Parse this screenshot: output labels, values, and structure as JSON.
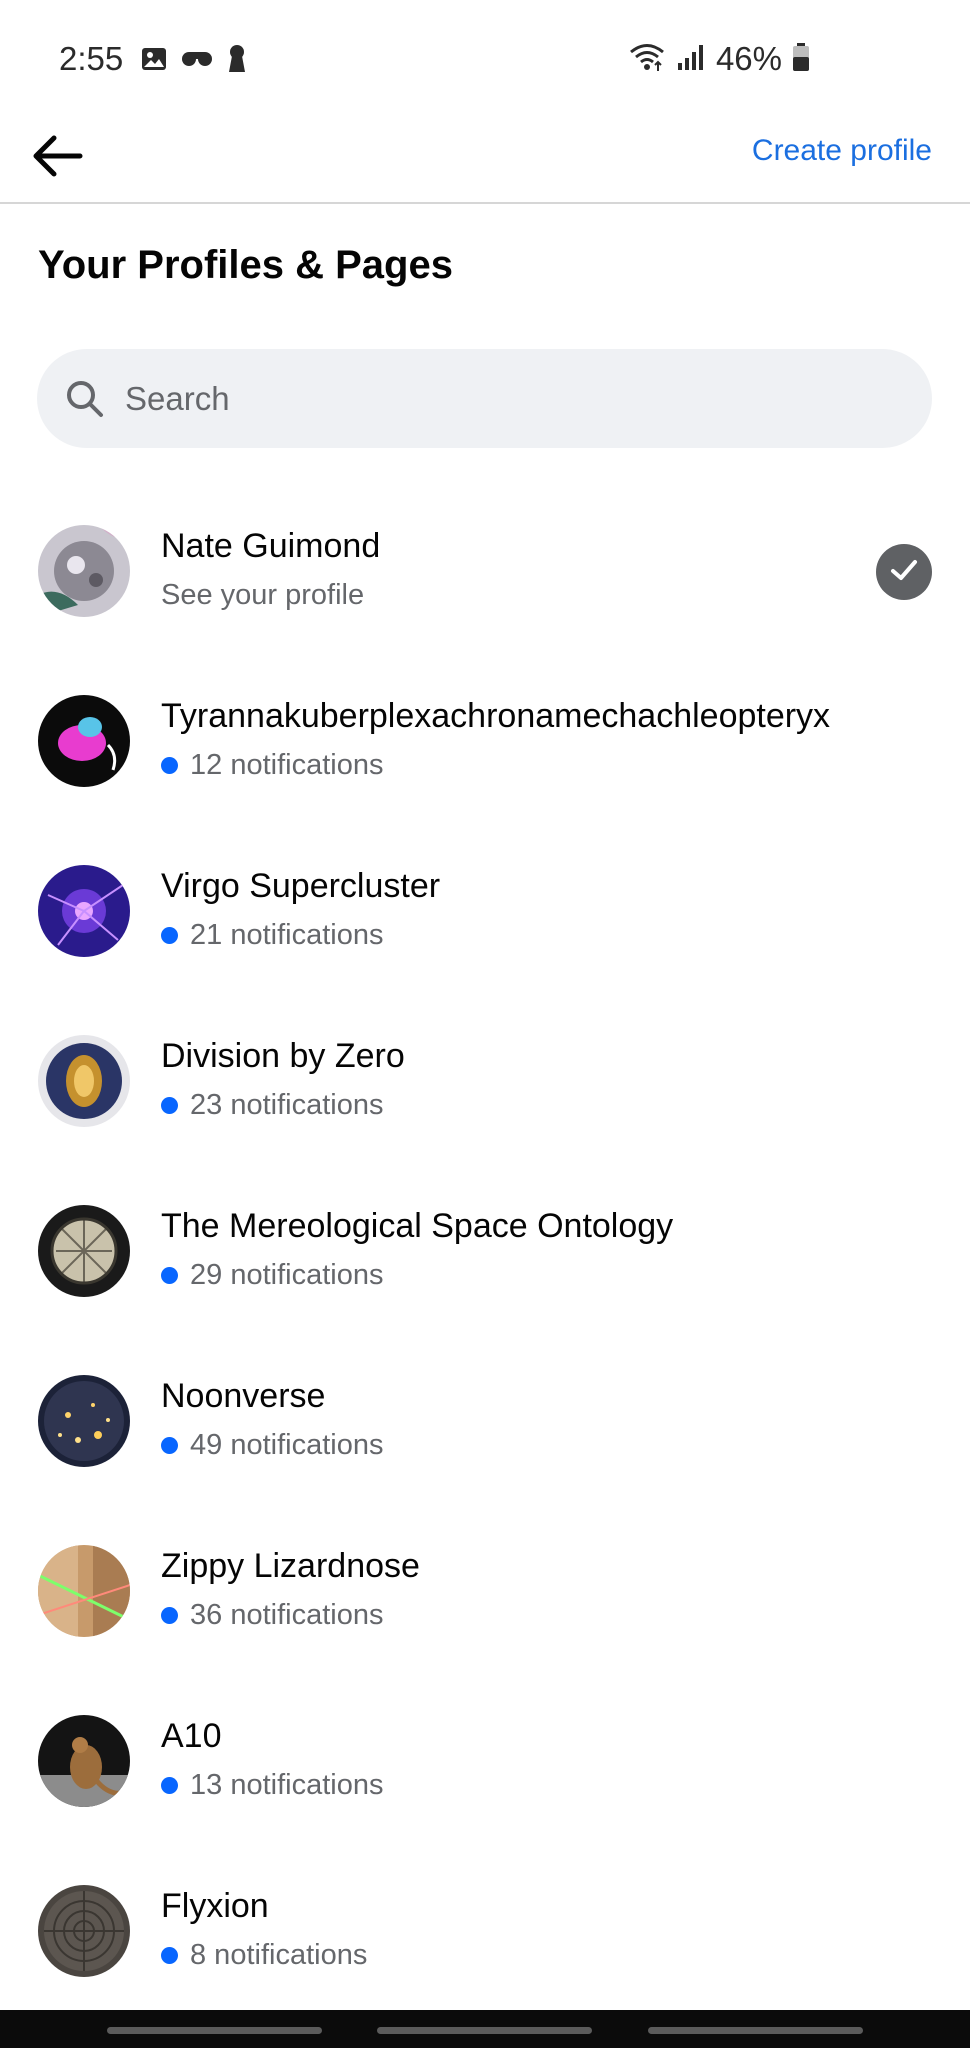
{
  "status_bar": {
    "time": "2:55",
    "battery": "46%",
    "left_icons": [
      "image-icon",
      "voicemail-icon",
      "keyhole-icon"
    ],
    "right_icons": [
      "wifi-icon",
      "signal-icon",
      "battery-icon"
    ]
  },
  "header": {
    "back_icon": "back-arrow-icon",
    "create_profile_label": "Create profile"
  },
  "page_title": "Your Profiles & Pages",
  "search": {
    "placeholder": "Search",
    "value": ""
  },
  "profiles": [
    {
      "name": "Nate Guimond",
      "subtitle": "See your profile",
      "selected": true,
      "has_notifications": false
    },
    {
      "name": "Tyrannakuberplexachronamechachleopteryx",
      "subtitle": "12 notifications",
      "has_notifications": true
    },
    {
      "name": "Virgo Supercluster",
      "subtitle": "21 notifications",
      "has_notifications": true
    },
    {
      "name": "Division by Zero",
      "subtitle": "23 notifications",
      "has_notifications": true
    },
    {
      "name": "The Mereological Space Ontology",
      "subtitle": "29 notifications",
      "has_notifications": true
    },
    {
      "name": "Noonverse",
      "subtitle": "49 notifications",
      "has_notifications": true
    },
    {
      "name": "Zippy Lizardnose",
      "subtitle": "36 notifications",
      "has_notifications": true
    },
    {
      "name": "A10",
      "subtitle": "13 notifications",
      "has_notifications": true
    },
    {
      "name": "Flyxion",
      "subtitle": "8 notifications",
      "has_notifications": true
    }
  ],
  "colors": {
    "accent": "#1b6fe0",
    "notification_dot": "#0866ff",
    "check_badge": "#5f6164",
    "search_bg": "#eff1f4"
  }
}
